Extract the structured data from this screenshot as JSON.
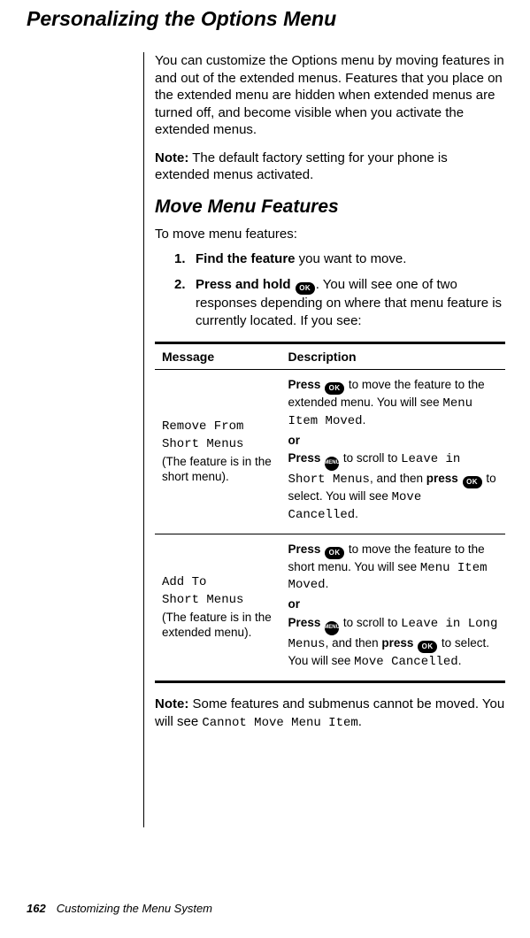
{
  "title": "Personalizing the Options Menu",
  "intro": "You can customize the Options menu by moving features in and out of the extended menus. Features that you place on the extended menu are hidden when extended menus are turned off, and become visible when you activate the extended menus.",
  "note1_label": "Note:",
  "note1_text": " The default factory setting for your phone is extended menus activated.",
  "subheading": "Move Menu Features",
  "lead_in": "To move menu features:",
  "steps": [
    {
      "num": "1.",
      "bold": "Find the feature",
      "rest": " you want to move."
    },
    {
      "num": "2.",
      "bold": "Press and hold ",
      "rest": ". You will see one of two responses depending on where that menu feature is currently located. If you see:"
    }
  ],
  "icons": {
    "ok": "OK",
    "menu": "MENU"
  },
  "table": {
    "head": {
      "message": "Message",
      "description": "Description"
    },
    "rows": [
      {
        "msg_line1": "Remove From",
        "msg_line2": "Short Menus",
        "msg_sub": "(The feature is in the short menu).",
        "desc": {
          "p1_a": "Press ",
          "p1_b": "  to move the feature to the extended menu. You will see ",
          "p1_lcd": "Menu Item Moved",
          "p1_c": ".",
          "or": "or",
          "p2_a": "Press ",
          "p2_b": " to scroll to ",
          "p2_lcd1": "Leave in Short Menus",
          "p2_c": ", and then ",
          "p2_bold": "press",
          "p2_d": "  ",
          "p2_e": "  to select. You will see ",
          "p2_lcd2": "Move Cancelled",
          "p2_f": "."
        }
      },
      {
        "msg_line1": "Add To",
        "msg_line2": "Short Menus",
        "msg_sub": "(The feature is in the extended menu).",
        "desc": {
          "p1_a": "Press ",
          "p1_b": "  to move the feature to the short menu. You will see ",
          "p1_lcd": "Menu Item Moved",
          "p1_c": ".",
          "or": "or",
          "p2_a": "Press ",
          "p2_b": " to scroll to ",
          "p2_lcd1": "Leave in Long Menus",
          "p2_c": ", and then ",
          "p2_bold": "press",
          "p2_d": "  ",
          "p2_e": "  to select. You will see ",
          "p2_lcd2": "Move Cancelled",
          "p2_f": "."
        }
      }
    ]
  },
  "note2_label": "Note:",
  "note2_text_a": " Some features and submenus cannot be moved. You will see ",
  "note2_lcd": "Cannot Move Menu Item",
  "note2_text_b": ".",
  "footer": {
    "page": "162",
    "section": "Customizing the Menu System"
  }
}
